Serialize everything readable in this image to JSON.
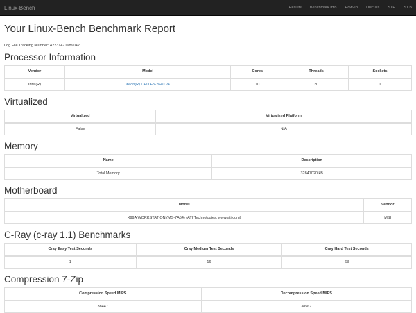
{
  "nav": {
    "brand": "Linux-Bench",
    "links": [
      "Results",
      "Benchmark Info",
      "How-To",
      "Discuss",
      "STH",
      "ST.B"
    ]
  },
  "title": "Your Linux-Bench Benchmark Report",
  "tracking": "Log File Tracking Number: 42231471989042",
  "processor": {
    "heading": "Processor Information",
    "headers": [
      "Vendor",
      "Model",
      "Cores",
      "Threads",
      "Sockets"
    ],
    "row": [
      "Intel(R)",
      "Xeon(R) CPU E5-2640 v4",
      "10",
      "20",
      "1"
    ]
  },
  "virtualized": {
    "heading": "Virtualized",
    "headers": [
      "Virtualized",
      "Virtualized Platform"
    ],
    "row": [
      "False",
      "N/A"
    ]
  },
  "memory": {
    "heading": "Memory",
    "headers": [
      "Name",
      "Description"
    ],
    "row": [
      "Total Memory",
      "32847020 kB"
    ]
  },
  "motherboard": {
    "heading": "Motherboard",
    "headers": [
      "Model",
      "Vendor"
    ],
    "row": [
      "X99A WORKSTATION (MS-7A54) (ATI Technologies, www.ati.com)",
      "MSI"
    ]
  },
  "cray": {
    "heading": "C-Ray (c-ray 1.1) Benchmarks",
    "headers": [
      "Cray Easy Test Seconds",
      "Cray Medium Test Seconds",
      "Cray Hard Test Seconds"
    ],
    "row": [
      "1",
      "16",
      "63"
    ]
  },
  "zip": {
    "heading": "Compression 7-Zip",
    "headers": [
      "Compression Speed MIPS",
      "Decompression Speed MIPS"
    ],
    "row": [
      "38447",
      "38567"
    ]
  }
}
